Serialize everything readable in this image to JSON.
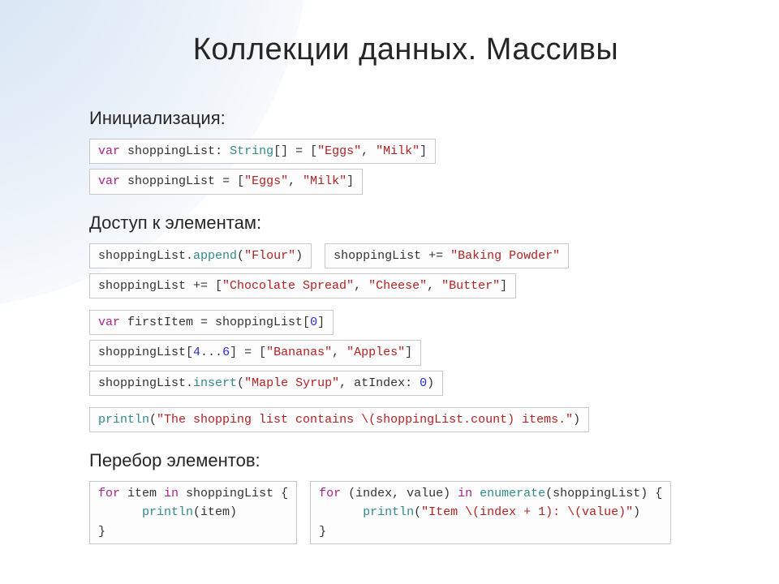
{
  "title": "Коллекции данных. Массивы",
  "sections": {
    "init": "Инициализация:",
    "access": "Доступ к элементам:",
    "iterate": "Перебор элементов:"
  },
  "code": {
    "init1": {
      "var": "var",
      "name": "shoppingList",
      "type": "String",
      "br": "[]",
      "eq": " = [",
      "s1": "\"Eggs\"",
      "c": ", ",
      "s2": "\"Milk\"",
      "end": "]"
    },
    "init2": {
      "var": "var",
      "name": "shoppingList",
      "eq": " = [",
      "s1": "\"Eggs\"",
      "c": ", ",
      "s2": "\"Milk\"",
      "end": "]"
    },
    "append": {
      "obj": "shoppingList.",
      "fn": "append",
      "open": "(",
      "s": "\"Flour\"",
      "close": ")"
    },
    "plus1": {
      "lhs": "shoppingList += ",
      "s": "\"Baking Powder\""
    },
    "plus2": {
      "lhs": "shoppingList += [",
      "s1": "\"Chocolate Spread\"",
      "c1": ", ",
      "s2": "\"Cheese\"",
      "c2": ", ",
      "s3": "\"Butter\"",
      "end": "]"
    },
    "first": {
      "var": "var",
      "name": " firstItem = shoppingList[",
      "n": "0",
      "end": "]"
    },
    "range": {
      "lhs": "shoppingList[",
      "n1": "4",
      "dots": "...",
      "n2": "6",
      "mid": "] = [",
      "s1": "\"Bananas\"",
      "c": ", ",
      "s2": "\"Apples\"",
      "end": "]"
    },
    "insert": {
      "obj": "shoppingList.",
      "fn": "insert",
      "open": "(",
      "s": "\"Maple Syrup\"",
      "mid": ", atIndex: ",
      "n": "0",
      "close": ")"
    },
    "println": {
      "fn": "println",
      "open": "(",
      "s": "\"The shopping list contains \\(shoppingList.count) items.\"",
      "close": ")"
    },
    "for1": {
      "for": "for",
      "mid1": " item ",
      "in": "in",
      "mid2": " shoppingList {",
      "line2a": "      ",
      "fn": "println",
      "line2b": "(item)",
      "line3": "}"
    },
    "for2": {
      "for": "for",
      "mid1": " (index, value) ",
      "in": "in",
      "mid2": " ",
      "enum": "enumerate",
      "mid3": "(shoppingList) {",
      "line2a": "      ",
      "fn": "println",
      "open": "(",
      "s": "\"Item \\(index + 1): \\(value)\"",
      "close": ")",
      "line3": "}"
    }
  }
}
